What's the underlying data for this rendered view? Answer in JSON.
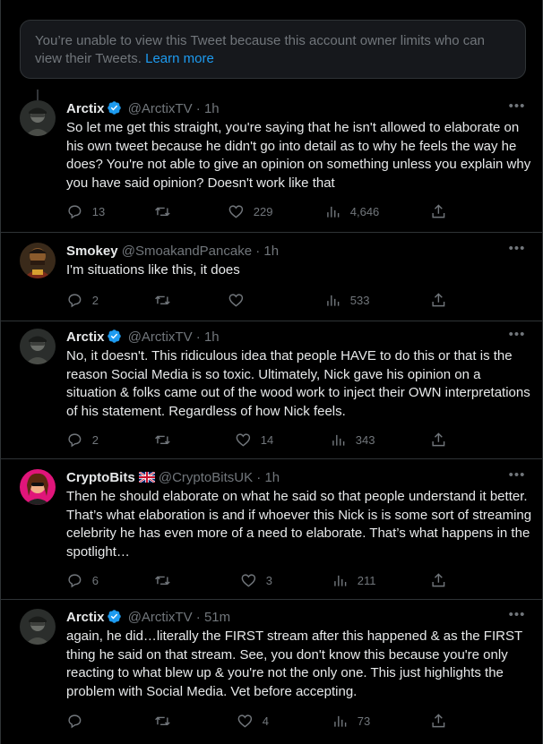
{
  "notice": {
    "text": "You’re unable to view this Tweet because this account owner limits who can view their Tweets.",
    "link": "Learn more"
  },
  "colors": {
    "accent": "#1d9bf0",
    "muted": "#71767b",
    "text": "#e7e9ea",
    "border": "#2f3336"
  },
  "tweets": [
    {
      "name": "Arctix",
      "verified": true,
      "handle": "@ArctixTV",
      "sep": "·",
      "time": "1h",
      "text": "So let me get this straight, you're saying that he isn't allowed to elaborate on his own tweet because he didn't go into detail as to why he feels the way he does? You're not able to give an opinion on something unless you explain why you have said opinion? Doesn't work like that",
      "replies": "13",
      "retweets": "",
      "likes": "229",
      "views": "4,646"
    },
    {
      "name": "Smokey",
      "verified": false,
      "handle": "@SmoakandPancake",
      "sep": "·",
      "time": "1h",
      "text": "I'm situations like this, it does",
      "replies": "2",
      "retweets": "",
      "likes": "",
      "views": "533"
    },
    {
      "name": "Arctix",
      "verified": true,
      "handle": "@ArctixTV",
      "sep": "·",
      "time": "1h",
      "text": "No, it doesn't. This ridiculous idea that people HAVE to do this or that is the reason Social Media is so toxic. Ultimately, Nick gave his opinion on a situation & folks came out of the wood work to inject their OWN interpretations of his statement. Regardless of how Nick feels.",
      "replies": "2",
      "retweets": "",
      "likes": "14",
      "views": "343"
    },
    {
      "name": "CryptoBits",
      "verified": false,
      "flag": "uk-flag",
      "handle": "@CryptoBitsUK",
      "sep": "·",
      "time": "1h",
      "text": "Then he should elaborate on what he said so that people understand it better.  That’s what elaboration is and if whoever this Nick is is some sort of streaming celebrity he has even more of a need to elaborate.  That’s what happens in the spotlight…",
      "replies": "6",
      "retweets": "",
      "likes": "3",
      "views": "211"
    },
    {
      "name": "Arctix",
      "verified": true,
      "handle": "@ArctixTV",
      "sep": "·",
      "time": "51m",
      "text": "again, he did…literally the FIRST stream after this happened & as the FIRST thing he said on that stream. See, you don't know this because you're only reacting to what blew up & you're not the only one. This just highlights the problem with Social Media. Vet before accepting.",
      "replies": "",
      "retweets": "",
      "likes": "4",
      "views": "73"
    }
  ]
}
